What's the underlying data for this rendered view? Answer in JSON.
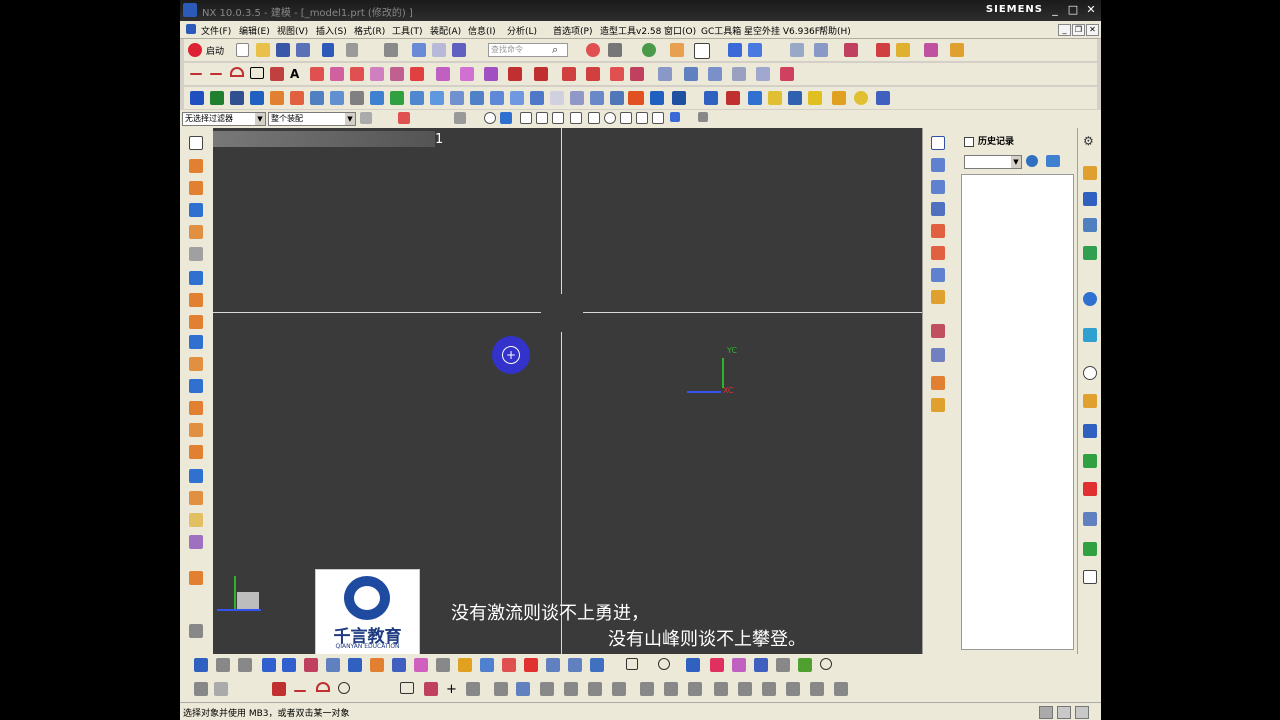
{
  "window": {
    "title": "NX 10.0.3.5 - 建模 - [_model1.prt (修改的) ]",
    "brand": "SIEMENS"
  },
  "menu": {
    "items": [
      "文件(F)",
      "编辑(E)",
      "视图(V)",
      "插入(S)",
      "格式(R)",
      "工具(T)",
      "装配(A)",
      "信息(I)",
      "分析(L)",
      "首选项(P)",
      "造型工具v2.58",
      "窗口(O)",
      "GC工具箱",
      "星空外挂 V6.936F",
      "帮助(H)"
    ]
  },
  "toolbar": {
    "start_label": "启动",
    "search_placeholder": "查找命令"
  },
  "filterbar": {
    "type_filter": "无选择过滤器",
    "scope": "整个装配"
  },
  "viewport": {
    "view_number": "1",
    "axis_y_label": "YC",
    "axis_x_label": "XC",
    "colors": {
      "background": "#3a3a3a",
      "y_axis": "#2cb52c",
      "x_axis": "#3355ee",
      "center_ball": "#3333cc"
    }
  },
  "overlay": {
    "logo_name": "千言教育",
    "logo_subtitle": "QIANYAN EDUCATION",
    "subtitle_line1": "没有激流则谈不上勇进，",
    "subtitle_line2": "没有山峰则谈不上攀登。"
  },
  "history_panel": {
    "title": "历史记录"
  },
  "statusbar": {
    "text": "选择对象并使用 MB3，或者双击某一对象"
  }
}
